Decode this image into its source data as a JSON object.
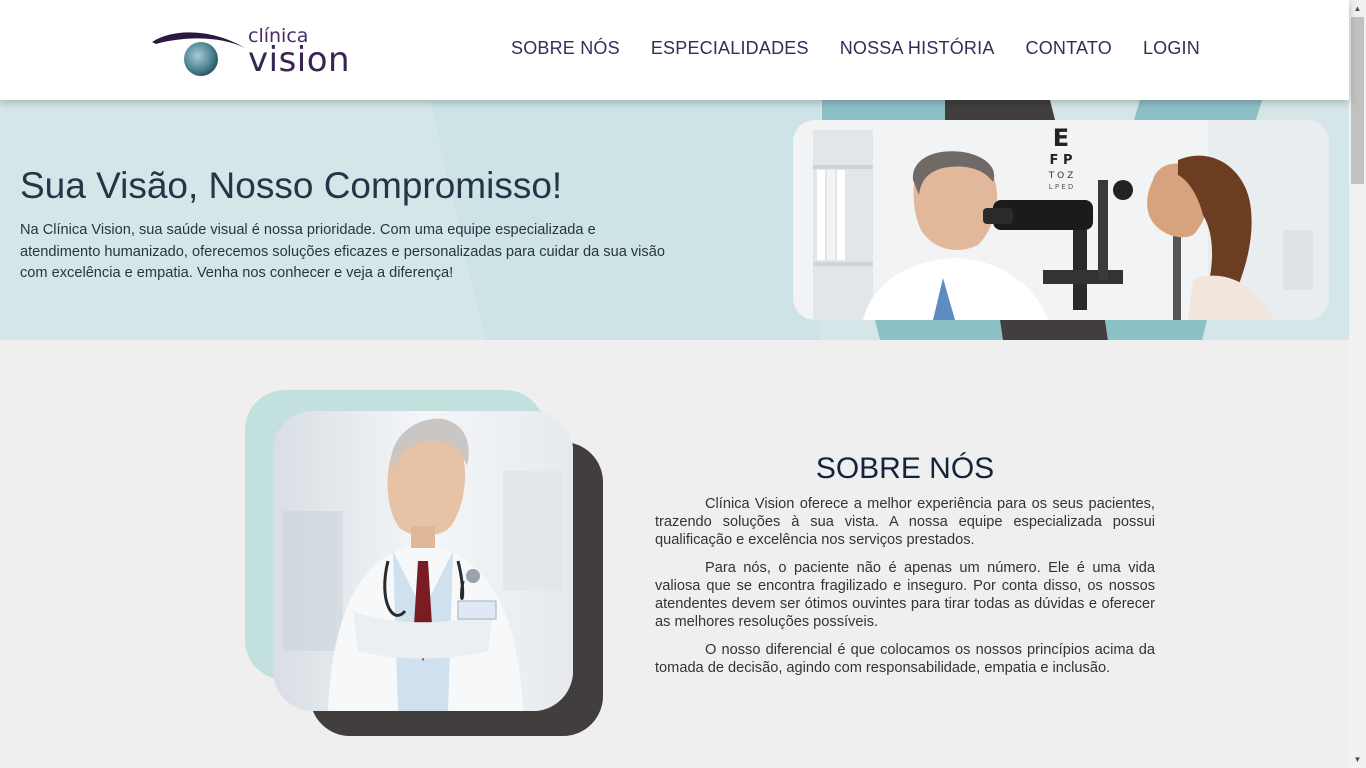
{
  "brand": {
    "small": "clínica",
    "big": "vision"
  },
  "nav": {
    "items": [
      {
        "label": "SOBRE NÓS"
      },
      {
        "label": "ESPECIALIDADES"
      },
      {
        "label": "NOSSA HISTÓRIA"
      },
      {
        "label": "CONTATO"
      },
      {
        "label": "LOGIN"
      }
    ]
  },
  "hero": {
    "title": "Sua Visão, Nosso Compromisso!",
    "text": "Na Clínica Vision, sua saúde visual é nossa prioridade. Com uma equipe especializada e atendimento humanizado, oferecemos soluções eficazes e personalizadas para cuidar da sua visão com excelência e empatia. Venha nos conhecer e veja a diferença!",
    "chart_letters": {
      "row1": "E",
      "row2": "F P",
      "row3": "T O Z",
      "row4": "L P E D"
    }
  },
  "about": {
    "title": "SOBRE NÓS",
    "paragraphs": [
      "Clínica Vision oferece a melhor experiência para os seus pacientes, trazendo soluções à sua vista. A nossa equipe especializada possui qualificação e excelência nos serviços prestados.",
      "Para nós, o paciente não é apenas um número. Ele é uma vida valiosa que se encontra fragilizado e inseguro. Por conta disso, os nossos atendentes devem ser ótimos ouvintes para tirar todas as dúvidas e oferecer as melhores resoluções possíveis.",
      "O nosso diferencial é que colocamos os nossos princípios acima da tomada de decisão, agindo com responsabilidade, empatia e inclusão."
    ]
  },
  "colors": {
    "hero_bg": "#d5e6e8",
    "accent_teal": "#c2e0dd",
    "accent_dark": "#423e3e",
    "brand_purple": "#3a2552"
  }
}
